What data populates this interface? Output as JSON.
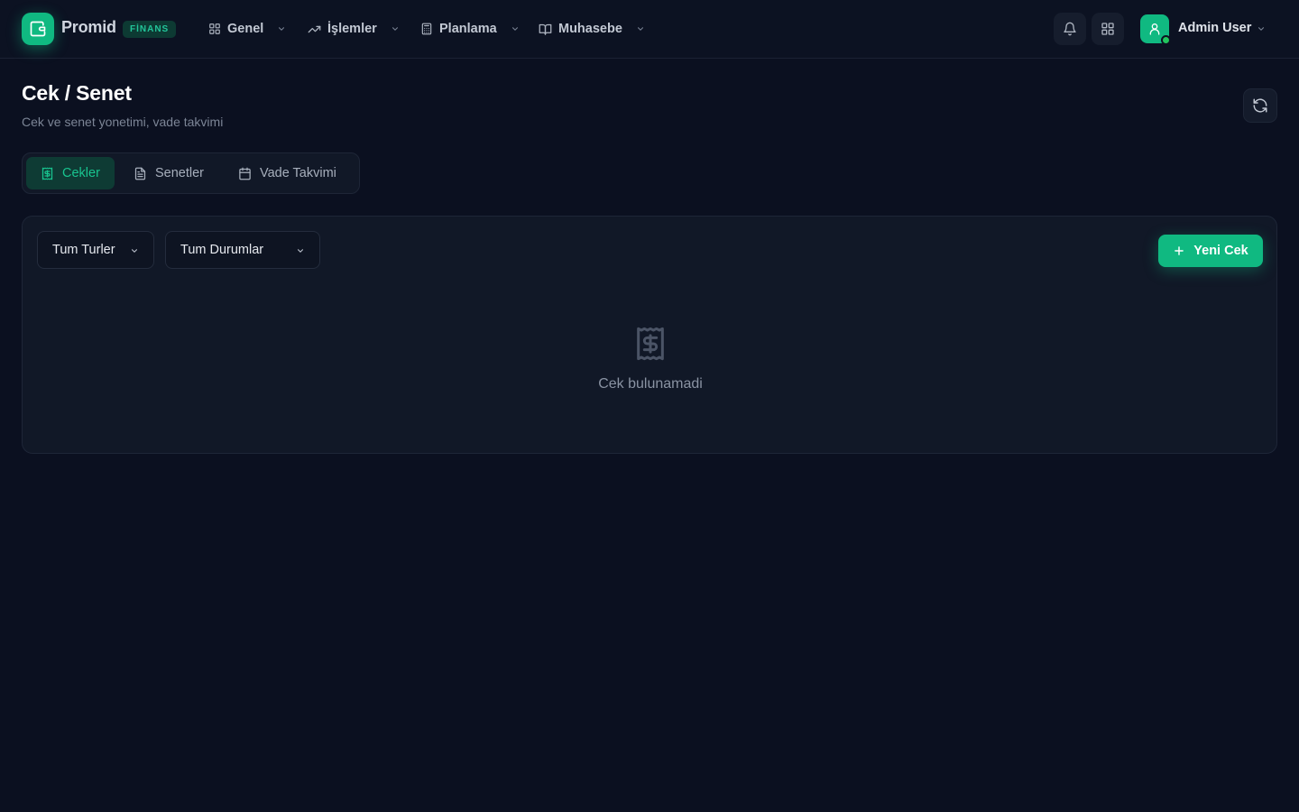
{
  "brand": {
    "name": "Promid",
    "badge": "FİNANS"
  },
  "nav": [
    {
      "label": "Genel",
      "icon": "grid-icon"
    },
    {
      "label": "İşlemler",
      "icon": "trending-up-icon"
    },
    {
      "label": "Planlama",
      "icon": "calculator-icon"
    },
    {
      "label": "Muhasebe",
      "icon": "book-open-icon"
    }
  ],
  "user": {
    "name": "Admin User",
    "status_color": "#22c55e"
  },
  "page": {
    "title": "Cek / Senet",
    "subtitle": "Cek ve senet yonetimi, vade takvimi"
  },
  "tabs": [
    {
      "label": "Cekler",
      "icon": "receipt-dollar-icon",
      "active": true
    },
    {
      "label": "Senetler",
      "icon": "file-text-icon",
      "active": false
    },
    {
      "label": "Vade Takvimi",
      "icon": "calendar-icon",
      "active": false
    }
  ],
  "filters": {
    "type": {
      "selected": "Tum Turler"
    },
    "status": {
      "selected": "Tum Durumlar"
    }
  },
  "actions": {
    "new_label": "Yeni Cek"
  },
  "empty_state": {
    "message": "Cek bulunamadi",
    "icon": "receipt-dollar-icon"
  },
  "colors": {
    "accent": "#10b981",
    "background": "#0b1020",
    "surface": "#111827"
  }
}
